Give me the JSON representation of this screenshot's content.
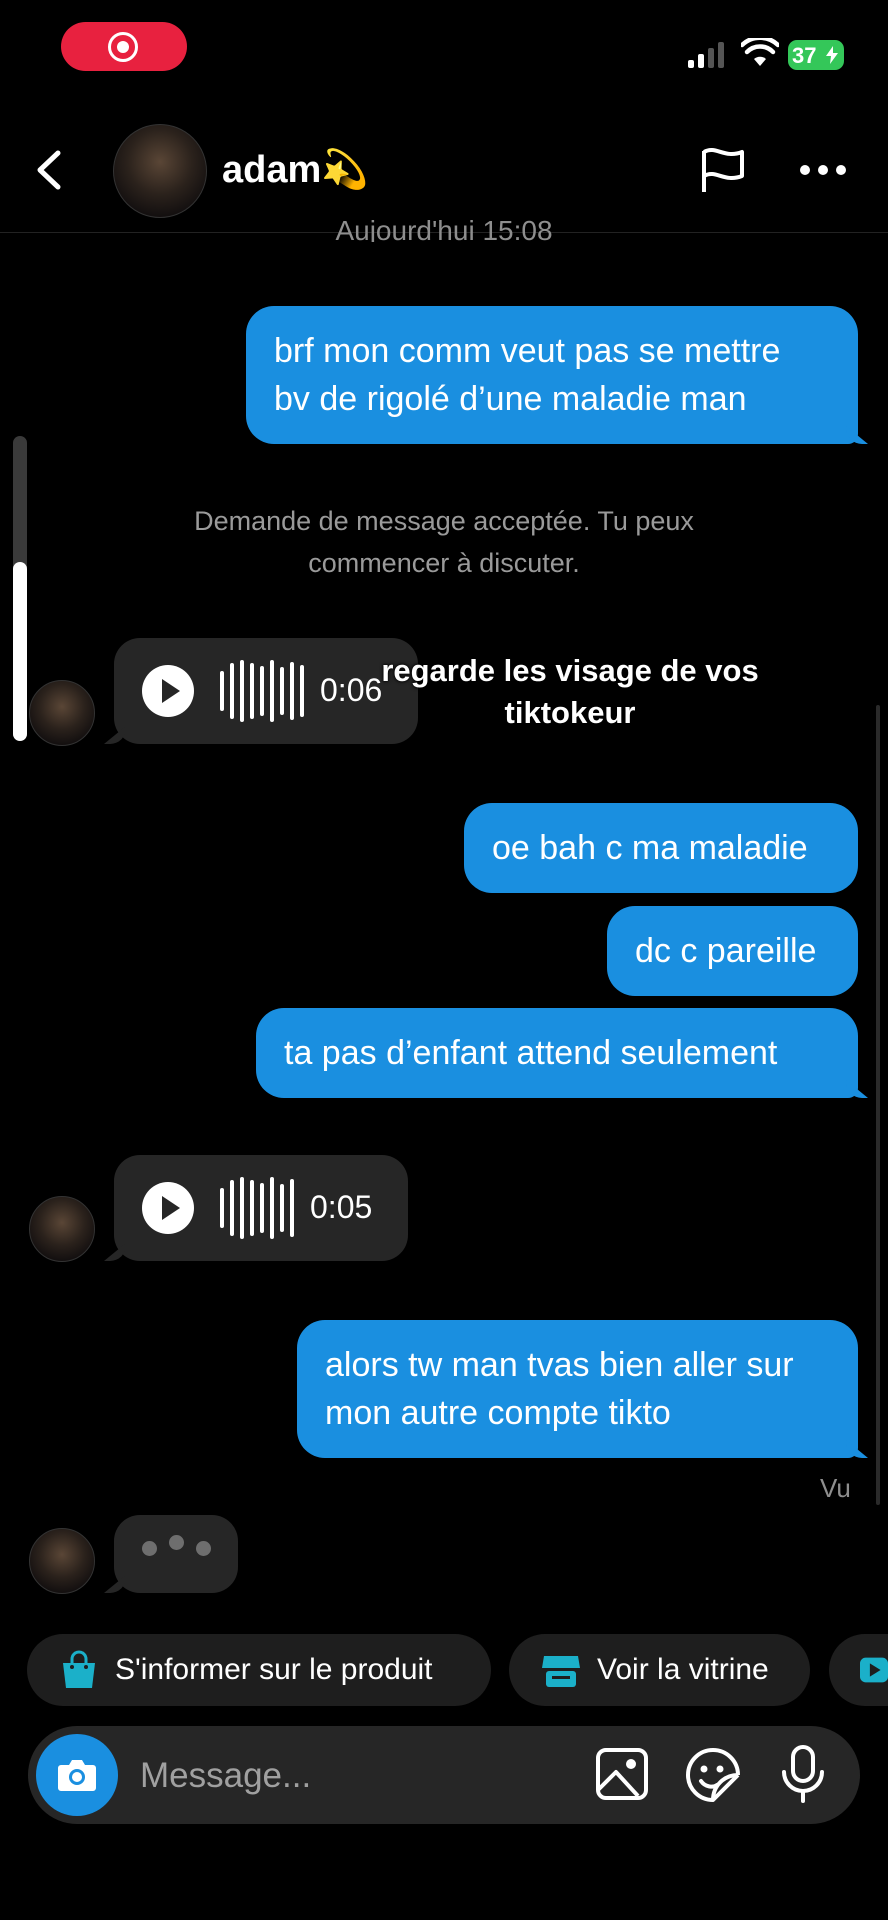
{
  "status_bar": {
    "battery": "37"
  },
  "header": {
    "name": "adam💫"
  },
  "date_separator": "Aujourd'hui 15:08",
  "messages": [
    {
      "type": "outgoing",
      "lines": [
        "brf mon comm veut pas se mettre",
        "bv de rigolé d’une maladie man"
      ]
    },
    {
      "type": "notice",
      "lines": [
        "Demande de message acceptée. Tu peux",
        "commencer à discuter."
      ]
    },
    {
      "type": "voice",
      "duration": "0:06"
    },
    {
      "type": "outgoing",
      "text": "oe bah c ma maladie"
    },
    {
      "type": "outgoing",
      "text": "dc c pareille"
    },
    {
      "type": "outgoing",
      "text": "ta pas d’enfant attend seulement"
    },
    {
      "type": "voice",
      "duration": "0:05"
    },
    {
      "type": "outgoing",
      "lines": [
        "alors tw man tvas bien aller sur",
        "mon autre compte tikto"
      ]
    }
  ],
  "seen_label": "Vu",
  "overlay_caption": {
    "lines": [
      "regarde les visage de vos",
      "tiktokeur"
    ]
  },
  "chips": [
    {
      "label": "S'informer sur le produit",
      "icon": "shopping-bag-icon"
    },
    {
      "label": "Voir la vitrine",
      "icon": "storefront-icon"
    }
  ],
  "composer": {
    "placeholder": "Message..."
  },
  "colors": {
    "accent": "#1a8fe0",
    "chip_icon": "#1bb0c9",
    "record": "#e8213f",
    "battery": "#34c759"
  }
}
